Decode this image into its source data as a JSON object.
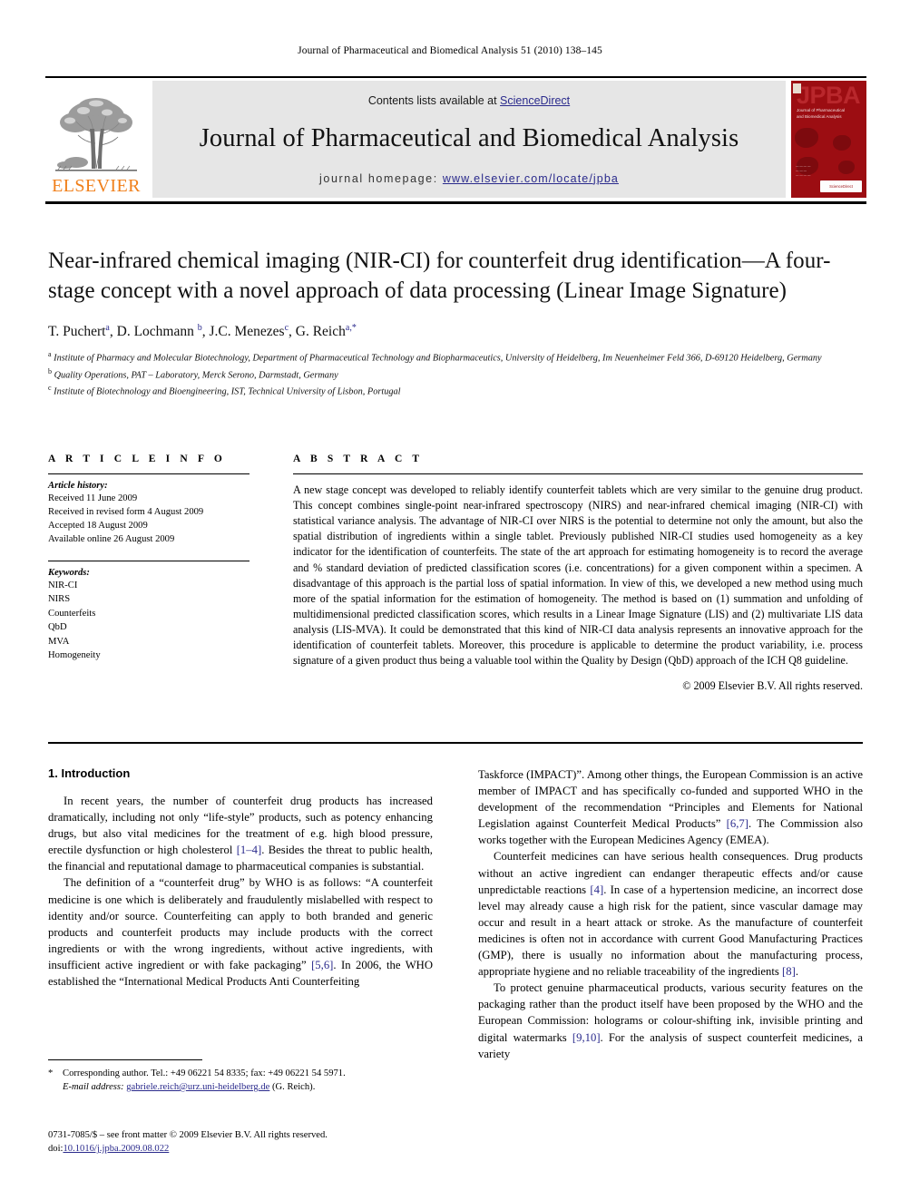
{
  "running_head": "Journal of Pharmaceutical and Biomedical Analysis 51 (2010) 138–145",
  "masthead": {
    "publisher_name": "ELSEVIER",
    "contents_prefix": "Contents lists available at ",
    "contents_link": "ScienceDirect",
    "journal_title": "Journal of Pharmaceutical and Biomedical Analysis",
    "homepage_prefix": "journal homepage: ",
    "homepage_url": "www.elsevier.com/locate/jpba",
    "cover": {
      "acronym": "JPBA",
      "subtitle": "Journal of Pharmaceutical and Biomedical Analysis",
      "badge": "ScienceDirect"
    },
    "colors": {
      "link": "#2a2a8c",
      "elsevier_orange": "#F07F1A",
      "band_gray": "#e6e6e6",
      "cover_red": "#9c0d12"
    }
  },
  "article": {
    "title": "Near-infrared chemical imaging (NIR-CI) for counterfeit drug identification—A four-stage concept with a novel approach of data processing (Linear Image Signature)",
    "authors": [
      {
        "name": "T. Puchert",
        "marks": "a"
      },
      {
        "name": "D. Lochmann",
        "marks": "b"
      },
      {
        "name": "J.C. Menezes",
        "marks": "c"
      },
      {
        "name": "G. Reich",
        "marks": "a,*"
      }
    ],
    "affiliations": [
      {
        "mark": "a",
        "text": "Institute of Pharmacy and Molecular Biotechnology, Department of Pharmaceutical Technology and Biopharmaceutics, University of Heidelberg, Im Neuenheimer Feld 366, D-69120 Heidelberg, Germany"
      },
      {
        "mark": "b",
        "text": "Quality Operations, PAT – Laboratory, Merck Serono, Darmstadt, Germany"
      },
      {
        "mark": "c",
        "text": "Institute of Biotechnology and Bioengineering, IST, Technical University of Lisbon, Portugal"
      }
    ]
  },
  "article_info": {
    "heading": "A R T I C L E   I N F O",
    "history_label": "Article history:",
    "history": [
      "Received 11 June 2009",
      "Received in revised form 4 August 2009",
      "Accepted 18 August 2009",
      "Available online 26 August 2009"
    ],
    "keywords_label": "Keywords:",
    "keywords": [
      "NIR-CI",
      "NIRS",
      "Counterfeits",
      "QbD",
      "MVA",
      "Homogeneity"
    ]
  },
  "abstract": {
    "heading": "A B S T R A C T",
    "text": "A new stage concept was developed to reliably identify counterfeit tablets which are very similar to the genuine drug product. This concept combines single-point near-infrared spectroscopy (NIRS) and near-infrared chemical imaging (NIR-CI) with statistical variance analysis. The advantage of NIR-CI over NIRS is the potential to determine not only the amount, but also the spatial distribution of ingredients within a single tablet. Previously published NIR-CI studies used homogeneity as a key indicator for the identification of counterfeits. The state of the art approach for estimating homogeneity is to record the average and % standard deviation of predicted classification scores (i.e. concentrations) for a given component within a specimen. A disadvantage of this approach is the partial loss of spatial information. In view of this, we developed a new method using much more of the spatial information for the estimation of homogeneity. The method is based on (1) summation and unfolding of multidimensional predicted classification scores, which results in a Linear Image Signature (LIS) and (2) multivariate LIS data analysis (LIS-MVA). It could be demonstrated that this kind of NIR-CI data analysis represents an innovative approach for the identification of counterfeit tablets. Moreover, this procedure is applicable to determine the product variability, i.e. process signature of a given product thus being a valuable tool within the Quality by Design (QbD) approach of the ICH Q8 guideline.",
    "copyright": "© 2009 Elsevier B.V. All rights reserved."
  },
  "body": {
    "section_heading": "1.  Introduction",
    "left_paragraphs": [
      "In recent years, the number of counterfeit drug products has increased dramatically, including not only “life-style” products, such as potency enhancing drugs, but also vital medicines for the treatment of e.g. high blood pressure, erectile dysfunction or high cholesterol [1–4]. Besides the threat to public health, the financial and reputational damage to pharmaceutical companies is substantial.",
      "The definition of a “counterfeit drug” by WHO is as follows: “A counterfeit medicine is one which is deliberately and fraudulently mislabelled with respect to identity and/or source. Counterfeiting can apply to both branded and generic products and counterfeit products may include products with the correct ingredients or with the wrong ingredients, without active ingredients, with insufficient active ingredient or with fake packaging” [5,6]. In 2006, the WHO established the “International Medical Products Anti Counterfeiting"
    ],
    "right_paragraphs": [
      "Taskforce (IMPACT)”. Among other things, the European Commission is an active member of IMPACT and has specifically co-funded and supported WHO in the development of the recommendation “Principles and Elements for National Legislation against Counterfeit Medical Products” [6,7]. The Commission also works together with the European Medicines Agency (EMEA).",
      "Counterfeit medicines can have serious health consequences. Drug products without an active ingredient can endanger therapeutic effects and/or cause unpredictable reactions [4]. In case of a hypertension medicine, an incorrect dose level may already cause a high risk for the patient, since vascular damage may occur and result in a heart attack or stroke. As the manufacture of counterfeit medicines is often not in accordance with current Good Manufacturing Practices (GMP), there is usually no information about the manufacturing process, appropriate hygiene and no reliable traceability of the ingredients [8].",
      "To protect genuine pharmaceutical products, various security features on the packaging rather than the product itself have been proposed by the WHO and the European Commission: holograms or colour-shifting ink, invisible printing and digital watermarks [9,10]. For the analysis of suspect counterfeit medicines, a variety"
    ]
  },
  "footnotes": {
    "star": "*",
    "corresponding": "Corresponding author. Tel.: +49 06221 54 8335; fax: +49 06221 54 5971.",
    "email_label": "E-mail address:",
    "email": "gabriele.reich@urz.uni-heidelberg.de",
    "email_suffix": "(G. Reich).",
    "issn_line": "0731-7085/$ – see front matter © 2009 Elsevier B.V. All rights reserved.",
    "doi_label": "doi:",
    "doi": "10.1016/j.jpba.2009.08.022"
  }
}
